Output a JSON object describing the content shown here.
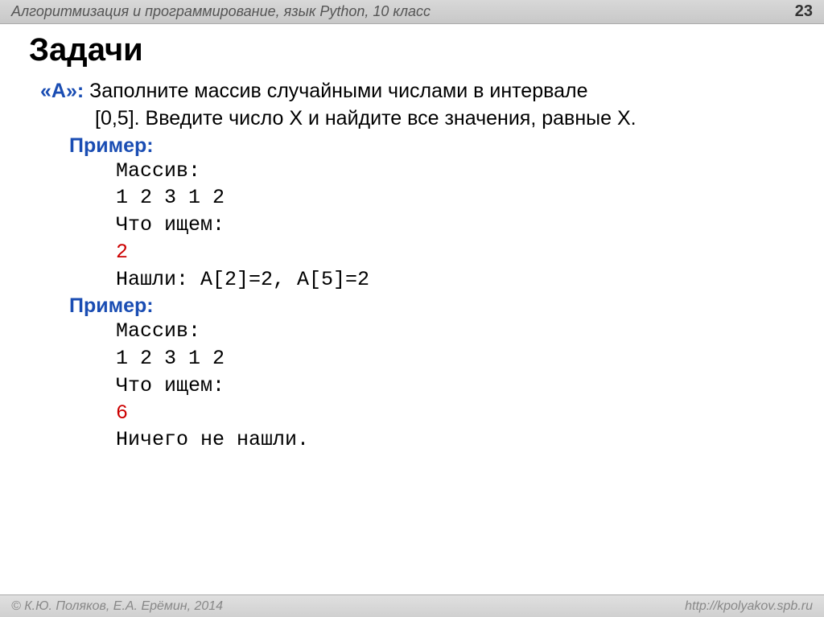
{
  "header": {
    "title": "Алгоритмизация и программирование, язык Python, 10 класс",
    "page_number": "23"
  },
  "title": "Задачи",
  "task": {
    "label": "«A»:",
    "line1": " Заполните массив случайными числами в интервале",
    "line2": "[0,5]. Введите число X и найдите все значения, равные X."
  },
  "examples": [
    {
      "label": "Пример:",
      "lines": [
        {
          "text": "Массив:",
          "highlight": false
        },
        {
          "text": "1 2 3 1 2",
          "highlight": false
        },
        {
          "text": "Что ищем:",
          "highlight": false
        },
        {
          "text": "2",
          "highlight": true
        },
        {
          "text": "Нашли: A[2]=2, A[5]=2",
          "highlight": false
        }
      ]
    },
    {
      "label": "Пример:",
      "lines": [
        {
          "text": "Массив:",
          "highlight": false
        },
        {
          "text": "1 2 3 1 2",
          "highlight": false
        },
        {
          "text": "Что ищем:",
          "highlight": false
        },
        {
          "text": "6",
          "highlight": true
        },
        {
          "text": "Ничего не нашли.",
          "highlight": false
        }
      ]
    }
  ],
  "footer": {
    "copyright": "© К.Ю. Поляков, Е.А. Ерёмин, 2014",
    "url": "http://kpolyakov.spb.ru"
  }
}
